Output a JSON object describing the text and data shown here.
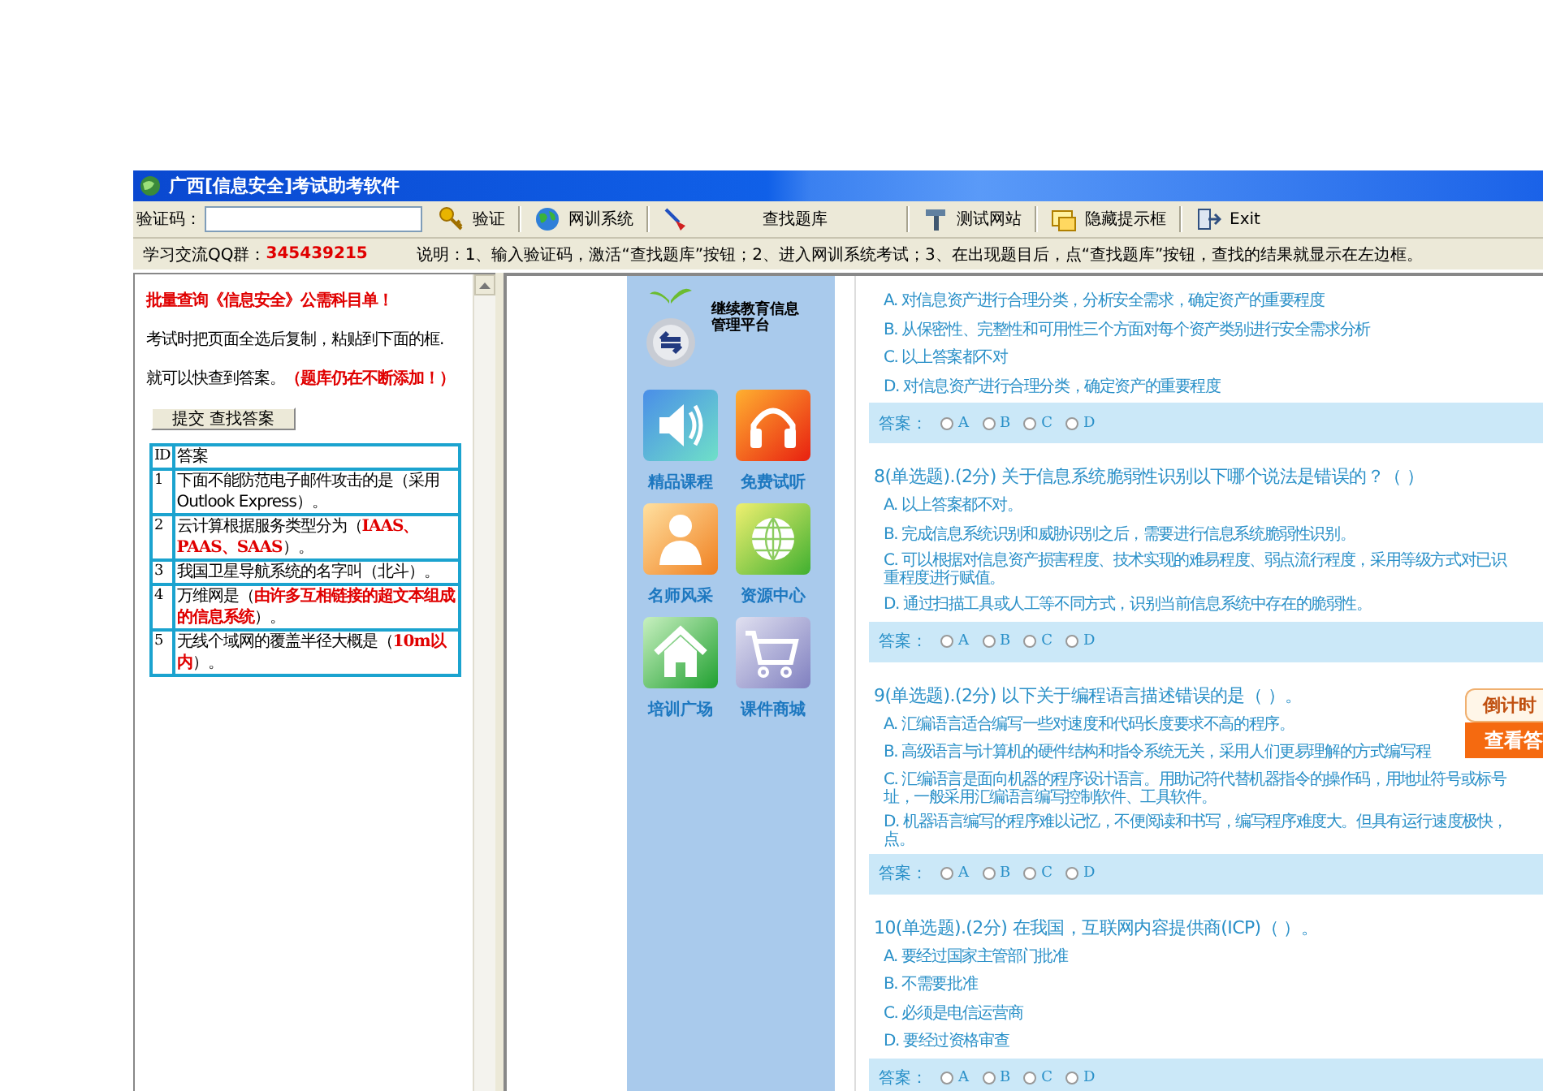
{
  "window": {
    "title": "广西[信息安全]考试助考软件"
  },
  "toolbar": {
    "code_label": "验证码：",
    "items": [
      {
        "kind": "verify",
        "label": "验证"
      },
      {
        "kind": "web",
        "label": "网训系统"
      },
      {
        "kind": "search",
        "label": "查找题库"
      },
      {
        "kind": "test",
        "label": "测试网站"
      },
      {
        "kind": "hide",
        "label": "隐藏提示框"
      },
      {
        "kind": "exit",
        "label": "Exit"
      }
    ]
  },
  "info_bar": {
    "group_label": "学习交流QQ群：",
    "group_number": "345439215",
    "instructions": "说明：1、输入验证码，激活“查找题库”按钮；2、进入网训系统考试；3、在出现题目后，点“查找题库”按钮，查找的结果就显示在左边框。"
  },
  "left_pane": {
    "heading": "批量查询《信息安全》公需科目单！",
    "instruction_1": "考试时把页面全选后复制，粘贴到下面的框.",
    "instruction_2": "就可以快查到答案。",
    "notice": "（题库仍在不断添加！）",
    "submit_button": "提交 查找答案",
    "table": {
      "columns": [
        "ID",
        "答案"
      ],
      "rows": [
        {
          "id": "1",
          "answer": "下面不能防范电子邮件攻击的是（采用Outlook Express）。"
        },
        {
          "id": "2",
          "answer": "云计算根据服务类型分为（**IAAS、PAAS、SAAS**）。"
        },
        {
          "id": "3",
          "answer": "我国卫星导航系统的名字叫（北斗）。"
        },
        {
          "id": "4",
          "answer": "万维网是（**由许多互相链接的超文本组成的信息系统**）。"
        },
        {
          "id": "5",
          "answer": "无线个域网的覆盖半径大概是（**10m以内**）。"
        }
      ]
    }
  },
  "portal": {
    "logo_text": [
      "继续教育信息",
      "管理平台"
    ],
    "tiles": [
      {
        "kind": "speaker",
        "label": "精品课程"
      },
      {
        "kind": "headphones",
        "label": "免费试听"
      },
      {
        "kind": "person",
        "label": "名师风采"
      },
      {
        "kind": "globe",
        "label": "资源中心"
      },
      {
        "kind": "house",
        "label": "培训广场"
      },
      {
        "kind": "cart",
        "label": "课件商城"
      }
    ]
  },
  "questions": [
    {
      "options": [
        {
          "lines": [
            "A. 对信息资产进行合理分类，分析安全需求，确定资产的重要程度"
          ]
        },
        {
          "lines": [
            "B. 从保密性、完整性和可用性三个方面对每个资产类别进行安全需求分析"
          ]
        },
        {
          "lines": [
            "C. 以上答案都不对"
          ]
        },
        {
          "lines": [
            "D. 对信息资产进行合理分类，确定资产的重要程度"
          ]
        }
      ],
      "answer": {
        "label": "答案：",
        "choices": [
          {
            "label": "A",
            "selected": false
          },
          {
            "label": "B",
            "selected": false
          },
          {
            "label": "C",
            "selected": false
          },
          {
            "label": "D",
            "selected": false
          }
        ]
      }
    },
    {
      "title": "8(单选题).(2分) 关于信息系统脆弱性识别以下哪个说法是错误的？（ ）",
      "options": [
        {
          "lines": [
            "A. 以上答案都不对。"
          ]
        },
        {
          "lines": [
            "B. 完成信息系统识别和威胁识别之后，需要进行信息系统脆弱性识别。"
          ]
        },
        {
          "lines": [
            "C. 可以根据对信息资产损害程度、技术实现的难易程度、弱点流行程度，采用等级方式对已识",
            "重程度进行赋值。"
          ]
        },
        {
          "lines": [
            "D. 通过扫描工具或人工等不同方式，识别当前信息系统中存在的脆弱性。"
          ]
        }
      ],
      "answer": {
        "label": "答案：",
        "choices": [
          {
            "label": "A",
            "selected": false
          },
          {
            "label": "B",
            "selected": false
          },
          {
            "label": "C",
            "selected": false
          },
          {
            "label": "D",
            "selected": false
          }
        ]
      }
    },
    {
      "title": "9(单选题).(2分) 以下关于编程语言描述错误的是（ ）。",
      "options": [
        {
          "lines": [
            "A. 汇编语言适合编写一些对速度和代码长度要求不高的程序。"
          ]
        },
        {
          "lines": [
            "B. 高级语言与计算机的硬件结构和指令系统无关，采用人们更易理解的方式编写程"
          ]
        },
        {
          "lines": [
            "C. 汇编语言是面向机器的程序设计语言。用助记符代替机器指令的操作码，用地址符号或标号",
            "址，一般采用汇编语言编写控制软件、工具软件。"
          ]
        },
        {
          "lines": [
            "D. 机器语言编写的程序难以记忆，不便阅读和书写，编写程序难度大。但具有运行速度极快，",
            "点。"
          ]
        }
      ],
      "answer": {
        "label": "答案：",
        "choices": [
          {
            "label": "A",
            "selected": false
          },
          {
            "label": "B",
            "selected": false
          },
          {
            "label": "C",
            "selected": false
          },
          {
            "label": "D",
            "selected": false
          }
        ]
      }
    },
    {
      "title": "10(单选题).(2分) 在我国，互联网内容提供商(ICP)（ ）。",
      "options": [
        {
          "lines": [
            "A. 要经过国家主管部门批准"
          ]
        },
        {
          "lines": [
            "B. 不需要批准"
          ]
        },
        {
          "lines": [
            "C. 必须是电信运营商"
          ]
        },
        {
          "lines": [
            "D. 要经过资格审查"
          ]
        }
      ],
      "answer": {
        "label": "答案：",
        "choices": [
          {
            "label": "A",
            "selected": false
          },
          {
            "label": "B",
            "selected": false
          },
          {
            "label": "C",
            "selected": false
          },
          {
            "label": "D",
            "selected": false
          }
        ]
      }
    }
  ],
  "countdown": {
    "label": "倒计时",
    "button": "查看答"
  }
}
